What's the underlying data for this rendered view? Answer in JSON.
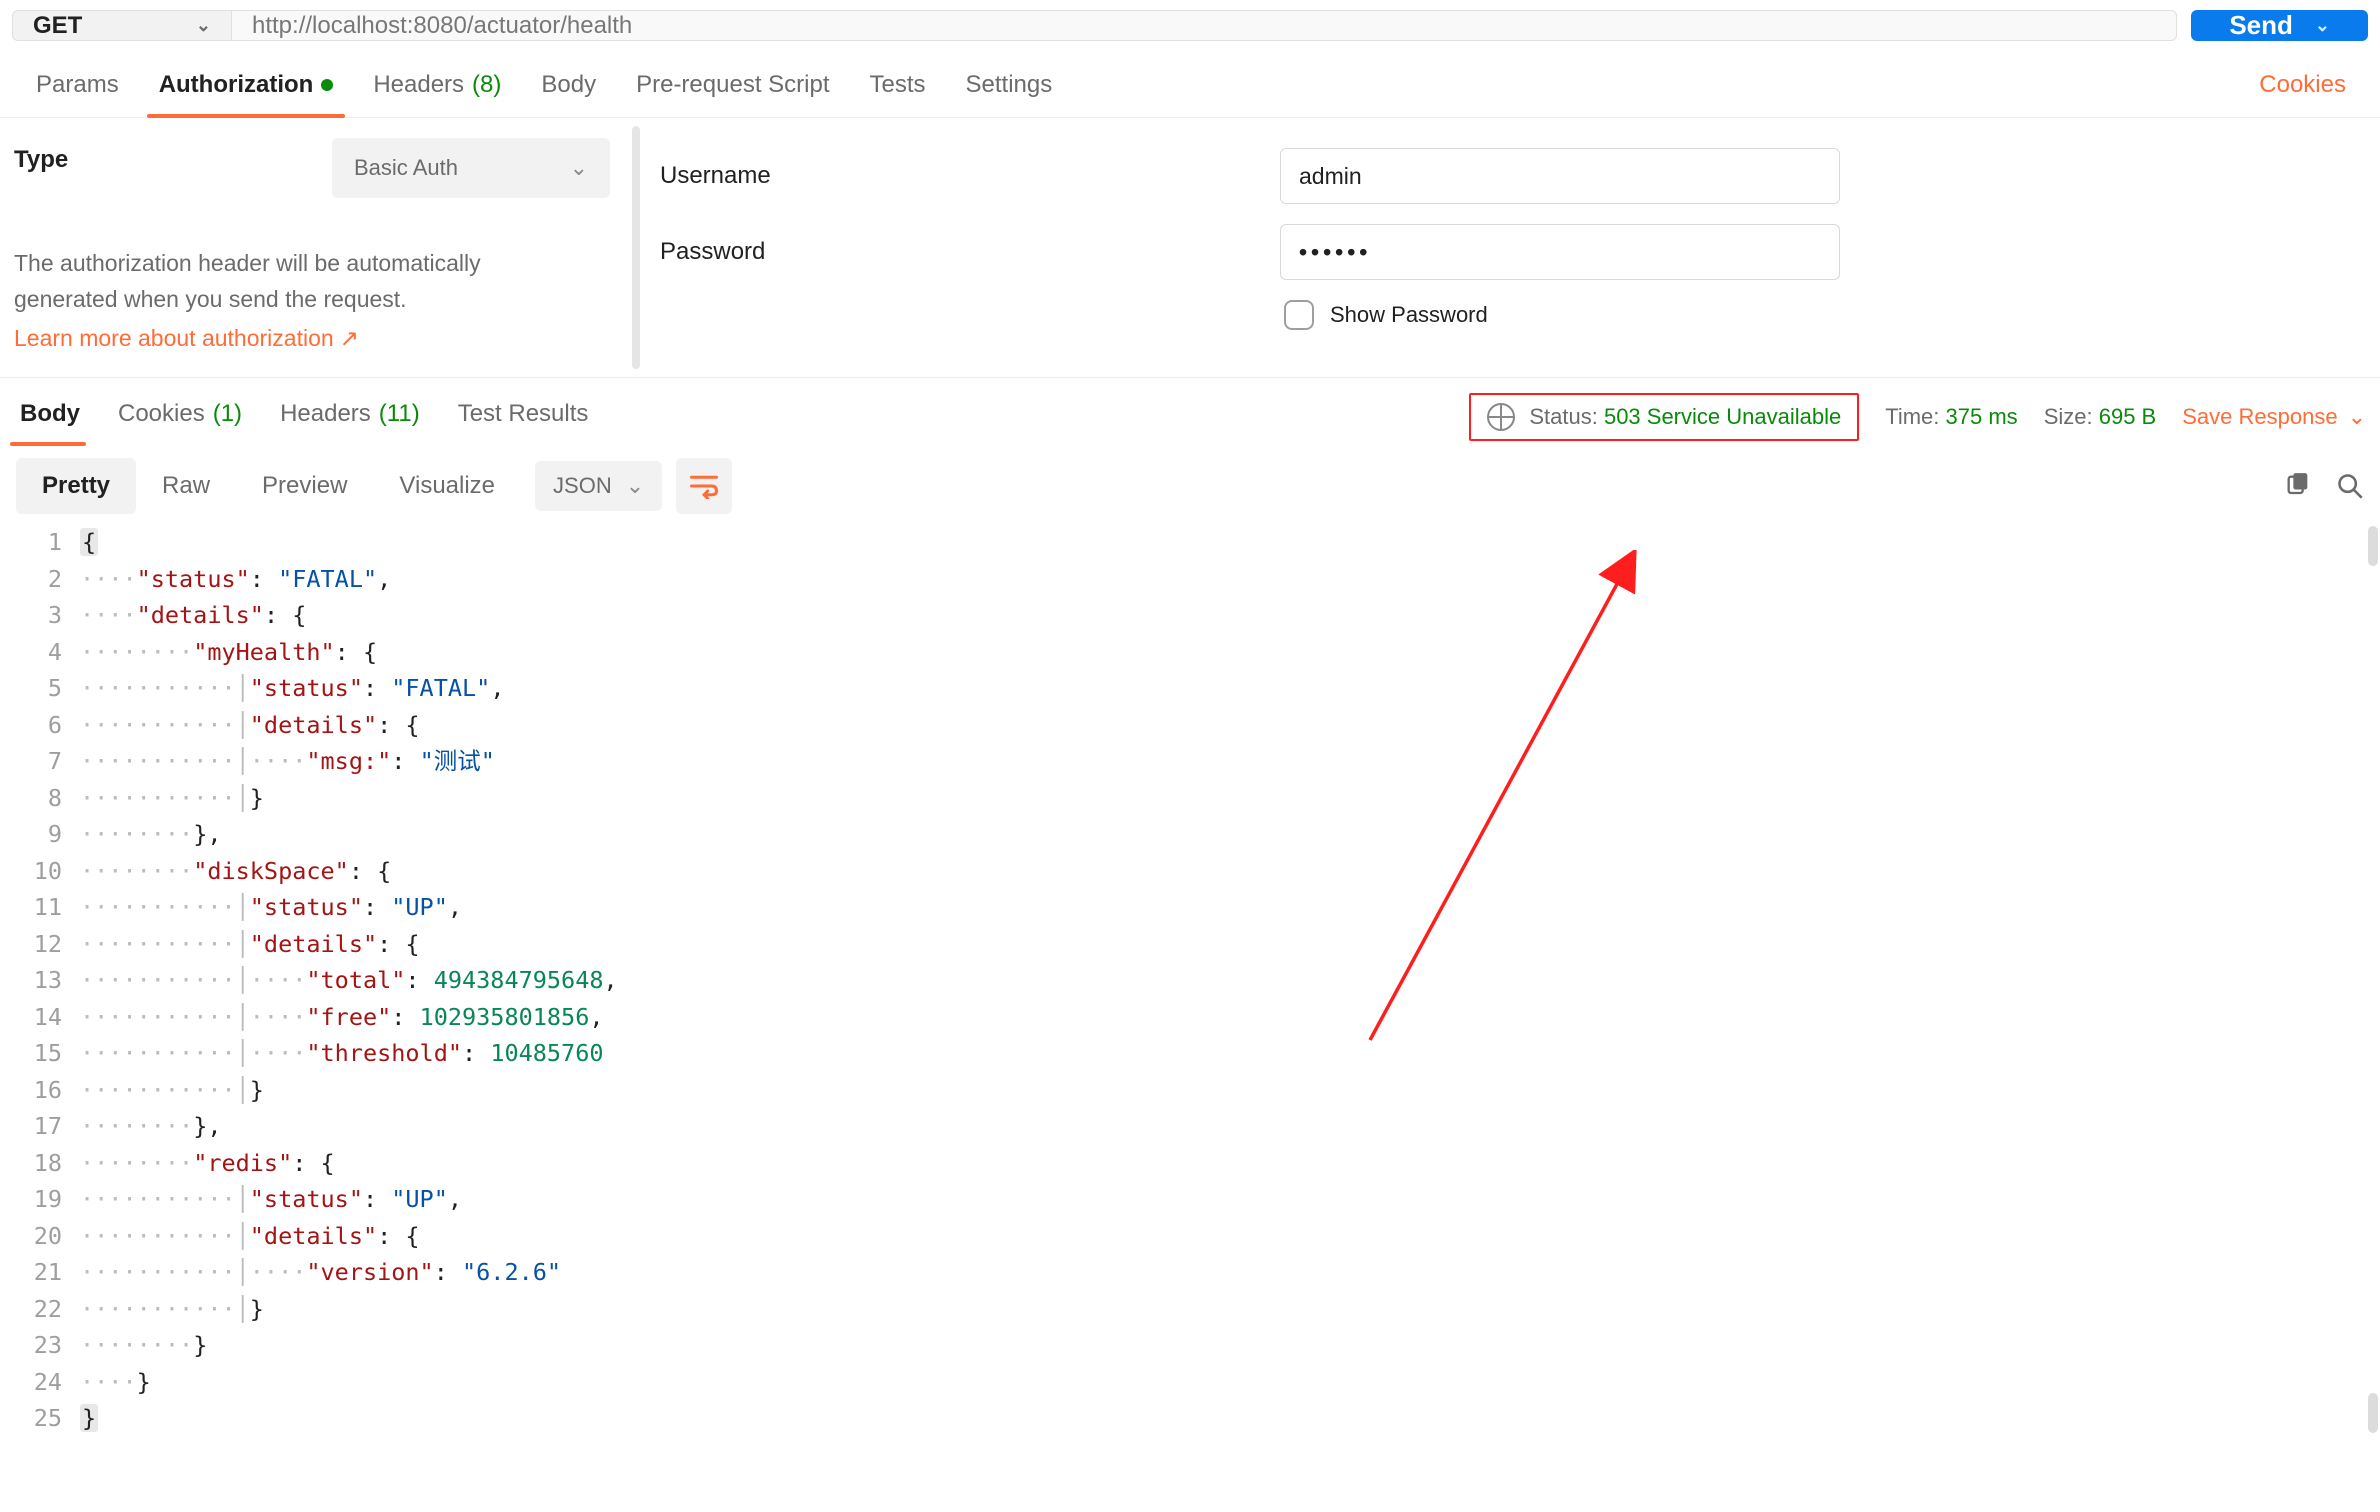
{
  "request": {
    "method": "GET",
    "url": "http://localhost:8080/actuator/health",
    "send_label": "Send"
  },
  "request_tabs": {
    "params": "Params",
    "authorization": "Authorization",
    "headers": "Headers",
    "headers_count": "(8)",
    "body": "Body",
    "prerequest": "Pre-request Script",
    "tests": "Tests",
    "settings": "Settings",
    "cookies": "Cookies"
  },
  "auth": {
    "type_label": "Type",
    "type_value": "Basic Auth",
    "desc": "The authorization header will be automatically generated when you send the request.",
    "learn": "Learn more about authorization",
    "username_label": "Username",
    "username_value": "admin",
    "password_label": "Password",
    "password_masked": "••••••",
    "show_password": "Show Password"
  },
  "response_tabs": {
    "body": "Body",
    "cookies": "Cookies",
    "cookies_count": "(1)",
    "headers": "Headers",
    "headers_count": "(11)",
    "test_results": "Test Results"
  },
  "response_meta": {
    "status_label": "Status:",
    "status_value": "503 Service Unavailable",
    "time_label": "Time:",
    "time_value": "375 ms",
    "size_label": "Size:",
    "size_value": "695 B",
    "save": "Save Response"
  },
  "viewer": {
    "pretty": "Pretty",
    "raw": "Raw",
    "preview": "Preview",
    "visualize": "Visualize",
    "lang": "JSON"
  },
  "response_body": {
    "status": "FATAL",
    "details": {
      "myHealth": {
        "status": "FATAL",
        "details": {
          "msg:": "测试"
        }
      },
      "diskSpace": {
        "status": "UP",
        "details": {
          "total": 494384795648,
          "free": 102935801856,
          "threshold": 10485760
        }
      },
      "redis": {
        "status": "UP",
        "details": {
          "version": "6.2.6"
        }
      }
    }
  },
  "code_lines": [
    [
      [
        "punc-hl",
        "{"
      ]
    ],
    [
      [
        "ind",
        1
      ],
      [
        "key",
        "\"status\""
      ],
      [
        "punc",
        ": "
      ],
      [
        "str",
        "\"FATAL\""
      ],
      [
        "punc",
        ","
      ]
    ],
    [
      [
        "ind",
        1
      ],
      [
        "key",
        "\"details\""
      ],
      [
        "punc",
        ": {"
      ]
    ],
    [
      [
        "ind",
        2
      ],
      [
        "key",
        "\"myHealth\""
      ],
      [
        "punc",
        ": {"
      ]
    ],
    [
      [
        "ind",
        3
      ],
      [
        "key",
        "\"status\""
      ],
      [
        "punc",
        ": "
      ],
      [
        "str",
        "\"FATAL\""
      ],
      [
        "punc",
        ","
      ]
    ],
    [
      [
        "ind",
        3
      ],
      [
        "key",
        "\"details\""
      ],
      [
        "punc",
        ": {"
      ]
    ],
    [
      [
        "ind",
        4
      ],
      [
        "key",
        "\"msg:\""
      ],
      [
        "punc",
        ": "
      ],
      [
        "str",
        "\"测试\""
      ]
    ],
    [
      [
        "ind",
        3
      ],
      [
        "punc",
        "}"
      ]
    ],
    [
      [
        "ind",
        2
      ],
      [
        "punc",
        "},"
      ]
    ],
    [
      [
        "ind",
        2
      ],
      [
        "key",
        "\"diskSpace\""
      ],
      [
        "punc",
        ": {"
      ]
    ],
    [
      [
        "ind",
        3
      ],
      [
        "key",
        "\"status\""
      ],
      [
        "punc",
        ": "
      ],
      [
        "str",
        "\"UP\""
      ],
      [
        "punc",
        ","
      ]
    ],
    [
      [
        "ind",
        3
      ],
      [
        "key",
        "\"details\""
      ],
      [
        "punc",
        ": {"
      ]
    ],
    [
      [
        "ind",
        4
      ],
      [
        "key",
        "\"total\""
      ],
      [
        "punc",
        ": "
      ],
      [
        "num",
        "494384795648"
      ],
      [
        "punc",
        ","
      ]
    ],
    [
      [
        "ind",
        4
      ],
      [
        "key",
        "\"free\""
      ],
      [
        "punc",
        ": "
      ],
      [
        "num",
        "102935801856"
      ],
      [
        "punc",
        ","
      ]
    ],
    [
      [
        "ind",
        4
      ],
      [
        "key",
        "\"threshold\""
      ],
      [
        "punc",
        ": "
      ],
      [
        "num",
        "10485760"
      ]
    ],
    [
      [
        "ind",
        3
      ],
      [
        "punc",
        "}"
      ]
    ],
    [
      [
        "ind",
        2
      ],
      [
        "punc",
        "},"
      ]
    ],
    [
      [
        "ind",
        2
      ],
      [
        "key",
        "\"redis\""
      ],
      [
        "punc",
        ": {"
      ]
    ],
    [
      [
        "ind",
        3
      ],
      [
        "key",
        "\"status\""
      ],
      [
        "punc",
        ": "
      ],
      [
        "str",
        "\"UP\""
      ],
      [
        "punc",
        ","
      ]
    ],
    [
      [
        "ind",
        3
      ],
      [
        "key",
        "\"details\""
      ],
      [
        "punc",
        ": {"
      ]
    ],
    [
      [
        "ind",
        4
      ],
      [
        "key",
        "\"version\""
      ],
      [
        "punc",
        ": "
      ],
      [
        "str",
        "\"6.2.6\""
      ]
    ],
    [
      [
        "ind",
        3
      ],
      [
        "punc",
        "}"
      ]
    ],
    [
      [
        "ind",
        2
      ],
      [
        "punc",
        "}"
      ]
    ],
    [
      [
        "ind",
        1
      ],
      [
        "punc",
        "}"
      ]
    ],
    [
      [
        "punc-hl",
        "}"
      ]
    ]
  ]
}
